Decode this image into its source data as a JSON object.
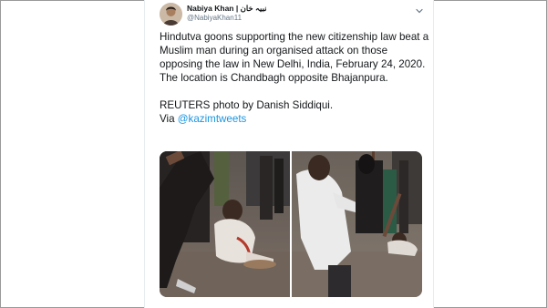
{
  "tweet": {
    "display_name": "Nabiya Khan | نبیہ خان",
    "handle": "@NabiyaKhan11",
    "text_lines": [
      "Hindutva goons supporting the new citizenship law beat a Muslim man during an organised attack on those opposing the law in New Delhi, India, February 24, 2020. The location is Chandbagh opposite Bhajanpura."
    ],
    "credit": "REUTERS photo by Danish Siddiqui.",
    "via_prefix": "Via ",
    "via_mention": "@kazimtweets",
    "icons": {
      "avatar": "user-avatar",
      "menu": "chevron-down-icon"
    },
    "colors": {
      "link": "#1b95e0",
      "text": "#14171a",
      "secondary": "#657786"
    }
  }
}
